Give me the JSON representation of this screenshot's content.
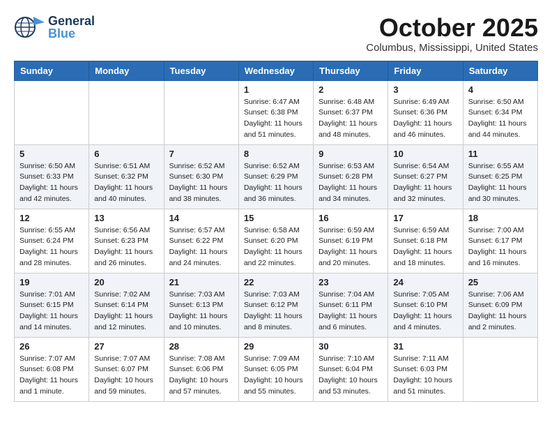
{
  "header": {
    "logo_general": "General",
    "logo_blue": "Blue",
    "month_title": "October 2025",
    "location": "Columbus, Mississippi, United States"
  },
  "days_of_week": [
    "Sunday",
    "Monday",
    "Tuesday",
    "Wednesday",
    "Thursday",
    "Friday",
    "Saturday"
  ],
  "weeks": [
    [
      {
        "day": "",
        "info": ""
      },
      {
        "day": "",
        "info": ""
      },
      {
        "day": "",
        "info": ""
      },
      {
        "day": "1",
        "sunrise": "6:47 AM",
        "sunset": "6:38 PM",
        "daylight": "11 hours and 51 minutes."
      },
      {
        "day": "2",
        "sunrise": "6:48 AM",
        "sunset": "6:37 PM",
        "daylight": "11 hours and 48 minutes."
      },
      {
        "day": "3",
        "sunrise": "6:49 AM",
        "sunset": "6:36 PM",
        "daylight": "11 hours and 46 minutes."
      },
      {
        "day": "4",
        "sunrise": "6:50 AM",
        "sunset": "6:34 PM",
        "daylight": "11 hours and 44 minutes."
      }
    ],
    [
      {
        "day": "5",
        "sunrise": "6:50 AM",
        "sunset": "6:33 PM",
        "daylight": "11 hours and 42 minutes."
      },
      {
        "day": "6",
        "sunrise": "6:51 AM",
        "sunset": "6:32 PM",
        "daylight": "11 hours and 40 minutes."
      },
      {
        "day": "7",
        "sunrise": "6:52 AM",
        "sunset": "6:30 PM",
        "daylight": "11 hours and 38 minutes."
      },
      {
        "day": "8",
        "sunrise": "6:52 AM",
        "sunset": "6:29 PM",
        "daylight": "11 hours and 36 minutes."
      },
      {
        "day": "9",
        "sunrise": "6:53 AM",
        "sunset": "6:28 PM",
        "daylight": "11 hours and 34 minutes."
      },
      {
        "day": "10",
        "sunrise": "6:54 AM",
        "sunset": "6:27 PM",
        "daylight": "11 hours and 32 minutes."
      },
      {
        "day": "11",
        "sunrise": "6:55 AM",
        "sunset": "6:25 PM",
        "daylight": "11 hours and 30 minutes."
      }
    ],
    [
      {
        "day": "12",
        "sunrise": "6:55 AM",
        "sunset": "6:24 PM",
        "daylight": "11 hours and 28 minutes."
      },
      {
        "day": "13",
        "sunrise": "6:56 AM",
        "sunset": "6:23 PM",
        "daylight": "11 hours and 26 minutes."
      },
      {
        "day": "14",
        "sunrise": "6:57 AM",
        "sunset": "6:22 PM",
        "daylight": "11 hours and 24 minutes."
      },
      {
        "day": "15",
        "sunrise": "6:58 AM",
        "sunset": "6:20 PM",
        "daylight": "11 hours and 22 minutes."
      },
      {
        "day": "16",
        "sunrise": "6:59 AM",
        "sunset": "6:19 PM",
        "daylight": "11 hours and 20 minutes."
      },
      {
        "day": "17",
        "sunrise": "6:59 AM",
        "sunset": "6:18 PM",
        "daylight": "11 hours and 18 minutes."
      },
      {
        "day": "18",
        "sunrise": "7:00 AM",
        "sunset": "6:17 PM",
        "daylight": "11 hours and 16 minutes."
      }
    ],
    [
      {
        "day": "19",
        "sunrise": "7:01 AM",
        "sunset": "6:15 PM",
        "daylight": "11 hours and 14 minutes."
      },
      {
        "day": "20",
        "sunrise": "7:02 AM",
        "sunset": "6:14 PM",
        "daylight": "11 hours and 12 minutes."
      },
      {
        "day": "21",
        "sunrise": "7:03 AM",
        "sunset": "6:13 PM",
        "daylight": "11 hours and 10 minutes."
      },
      {
        "day": "22",
        "sunrise": "7:03 AM",
        "sunset": "6:12 PM",
        "daylight": "11 hours and 8 minutes."
      },
      {
        "day": "23",
        "sunrise": "7:04 AM",
        "sunset": "6:11 PM",
        "daylight": "11 hours and 6 minutes."
      },
      {
        "day": "24",
        "sunrise": "7:05 AM",
        "sunset": "6:10 PM",
        "daylight": "11 hours and 4 minutes."
      },
      {
        "day": "25",
        "sunrise": "7:06 AM",
        "sunset": "6:09 PM",
        "daylight": "11 hours and 2 minutes."
      }
    ],
    [
      {
        "day": "26",
        "sunrise": "7:07 AM",
        "sunset": "6:08 PM",
        "daylight": "11 hours and 1 minute."
      },
      {
        "day": "27",
        "sunrise": "7:07 AM",
        "sunset": "6:07 PM",
        "daylight": "10 hours and 59 minutes."
      },
      {
        "day": "28",
        "sunrise": "7:08 AM",
        "sunset": "6:06 PM",
        "daylight": "10 hours and 57 minutes."
      },
      {
        "day": "29",
        "sunrise": "7:09 AM",
        "sunset": "6:05 PM",
        "daylight": "10 hours and 55 minutes."
      },
      {
        "day": "30",
        "sunrise": "7:10 AM",
        "sunset": "6:04 PM",
        "daylight": "10 hours and 53 minutes."
      },
      {
        "day": "31",
        "sunrise": "7:11 AM",
        "sunset": "6:03 PM",
        "daylight": "10 hours and 51 minutes."
      },
      {
        "day": "",
        "info": ""
      }
    ]
  ],
  "labels": {
    "sunrise_prefix": "Sunrise:",
    "sunset_prefix": "Sunset:",
    "daylight_prefix": "Daylight:"
  }
}
